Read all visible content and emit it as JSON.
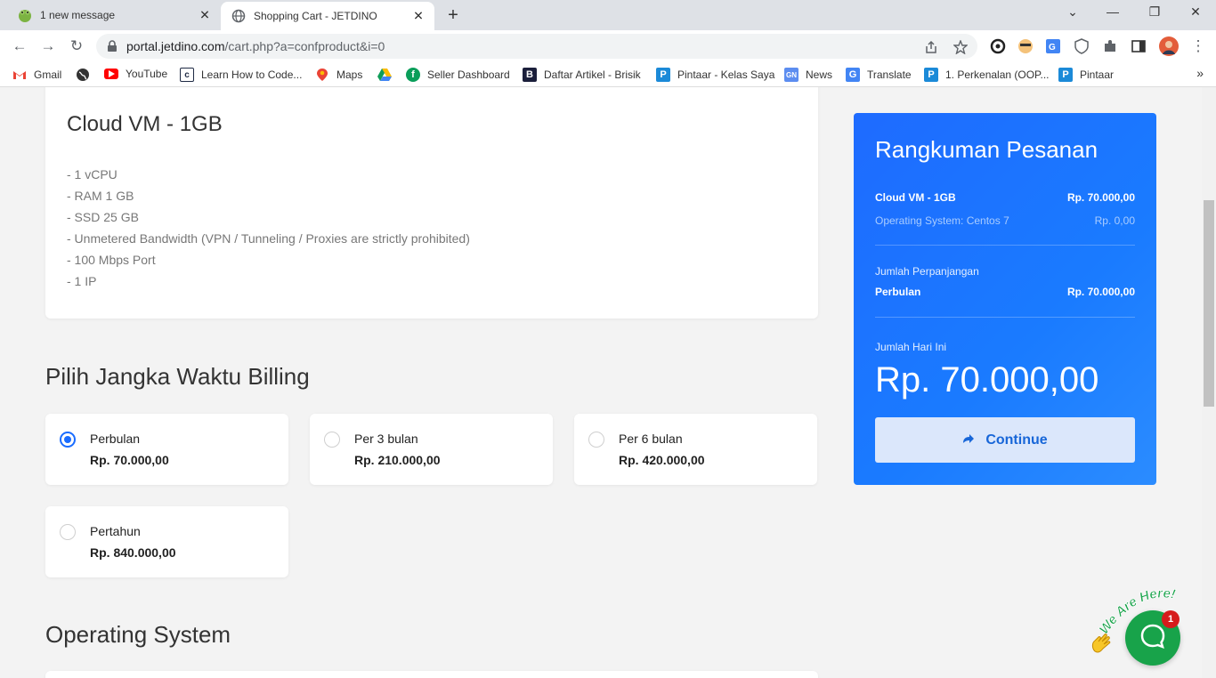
{
  "browser": {
    "tabs": [
      {
        "title": "1 new message",
        "active": false
      },
      {
        "title": "Shopping Cart - JETDINO",
        "active": true
      }
    ],
    "url_host": "portal.jetdino.com",
    "url_path": "/cart.php?a=confproduct&i=0",
    "bookmarks": [
      {
        "label": "Gmail",
        "icon": "gmail-icon"
      },
      {
        "label": "",
        "icon": "globe-icon"
      },
      {
        "label": "YouTube",
        "icon": "youtube-icon"
      },
      {
        "label": "Learn How to Code...",
        "icon": "codecademy-icon"
      },
      {
        "label": "Maps",
        "icon": "maps-icon"
      },
      {
        "label": "",
        "icon": "drive-icon"
      },
      {
        "label": "Seller Dashboard",
        "icon": "seller-icon"
      },
      {
        "label": "Daftar Artikel - Brisik",
        "icon": "brisik-icon"
      },
      {
        "label": "Pintaar - Kelas Saya",
        "icon": "pintaar-icon"
      },
      {
        "label": "News",
        "icon": "news-icon"
      },
      {
        "label": "Translate",
        "icon": "translate-icon"
      },
      {
        "label": "1. Perkenalan (OOP...",
        "icon": "pintaar-icon"
      },
      {
        "label": "Pintaar",
        "icon": "pintaar-icon"
      }
    ]
  },
  "product": {
    "name": "Cloud VM - 1GB",
    "features": [
      "- 1 vCPU",
      "- RAM 1 GB",
      "- SSD 25 GB",
      "- Unmetered Bandwidth (VPN / Tunneling / Proxies are strictly prohibited)",
      "- 100 Mbps Port",
      "- 1 IP"
    ]
  },
  "billing": {
    "heading": "Pilih Jangka Waktu Billing",
    "options": [
      {
        "name": "Perbulan",
        "price": "Rp. 70.000,00",
        "selected": true
      },
      {
        "name": "Per 3 bulan",
        "price": "Rp. 210.000,00",
        "selected": false
      },
      {
        "name": "Per 6 bulan",
        "price": "Rp. 420.000,00",
        "selected": false
      },
      {
        "name": "Pertahun",
        "price": "Rp. 840.000,00",
        "selected": false
      }
    ]
  },
  "os": {
    "heading": "Operating System"
  },
  "summary": {
    "title": "Rangkuman Pesanan",
    "product_name": "Cloud VM - 1GB",
    "product_price": "Rp. 70.000,00",
    "os_line": "Operating System: Centos 7",
    "os_price": "Rp. 0,00",
    "renewal_label": "Jumlah Perpanjangan",
    "renewal_cycle": "Perbulan",
    "renewal_price": "Rp. 70.000,00",
    "today_label": "Jumlah Hari Ini",
    "today_total": "Rp. 70.000,00",
    "continue_label": "Continue"
  },
  "chat": {
    "badge": "1",
    "tagline": "We Are Here!"
  },
  "colors": {
    "accent": "#1a6cff",
    "chat": "#18a34a",
    "badge": "#d61c1c"
  }
}
